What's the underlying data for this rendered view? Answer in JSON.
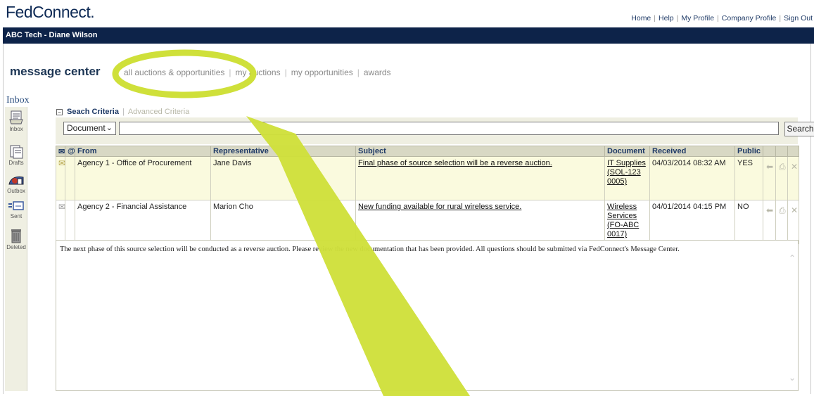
{
  "header": {
    "logo": "FedConnect.",
    "links": [
      "Home",
      "Help",
      "My Profile",
      "Company Profile",
      "Sign Out"
    ],
    "user": "ABC Tech - Diane Wilson"
  },
  "nav": {
    "title": "message center",
    "items": [
      "all auctions & opportunities",
      "my auctions",
      "my opportunities",
      "awards"
    ]
  },
  "folder_title": "Inbox",
  "sidebar": {
    "items": [
      "Inbox",
      "Drafts",
      "Outbox",
      "Sent",
      "Deleted"
    ]
  },
  "criteria": {
    "title": "Seach Criteria",
    "advanced": "Advanced Criteria",
    "doc_type": "Document",
    "query": "",
    "search_label": "Search"
  },
  "table": {
    "columns": [
      "",
      "",
      "From",
      "Representative",
      "Subject",
      "Document",
      "Received",
      "Public",
      "",
      "",
      ""
    ],
    "rows": [
      {
        "from": "Agency 1 - Office of Procurement",
        "representative": "Jane Davis",
        "subject": "Final phase of source selection will be a reverse auction.",
        "document": "IT Supplies (SOL-123 0005)",
        "received": "04/03/2014  08:32 AM",
        "public": "YES"
      },
      {
        "from": "Agency 2 - Financial Assistance",
        "representative": "Marion Cho",
        "subject": "New funding available for rural wireless service.",
        "document": "Wireless Services (FO-ABC 0017)",
        "received": "04/01/2014  04:15 PM",
        "public": "NO"
      }
    ]
  },
  "message": {
    "body": "The next phase of this source selection will be conducted as a reverse auction.  Please review the new documentation that has been provided.  All questions should be submitted via FedConnect's Message Center."
  },
  "colors": {
    "navy": "#0d2349",
    "highlight": "#cfe03a",
    "row_selected": "#fafade",
    "header_bg": "#d8d8c4"
  }
}
